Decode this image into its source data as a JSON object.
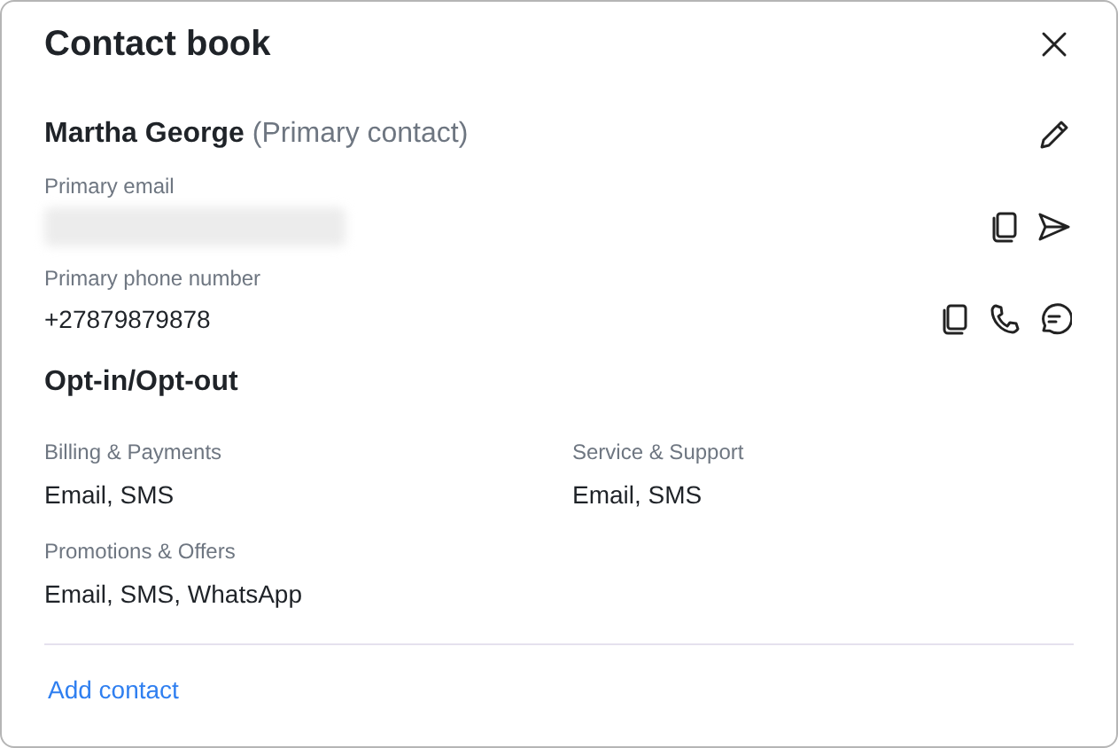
{
  "window": {
    "title": "Contact book"
  },
  "contact": {
    "name": "Martha George",
    "role": "(Primary contact)"
  },
  "fields": [
    {
      "kind": "email",
      "label": "Primary email",
      "redacted": true
    },
    {
      "kind": "phone",
      "label": "Primary phone number",
      "value": "+27879879878"
    }
  ],
  "opt_section": {
    "title": "Opt-in/Opt-out",
    "items": [
      {
        "label": "Billing & Payments",
        "value": "Email, SMS"
      },
      {
        "label": "Service & Support",
        "value": "Email, SMS"
      },
      {
        "label": "Promotions & Offers",
        "value": "Email, SMS, WhatsApp"
      }
    ]
  },
  "footer_link": "Add contact"
}
